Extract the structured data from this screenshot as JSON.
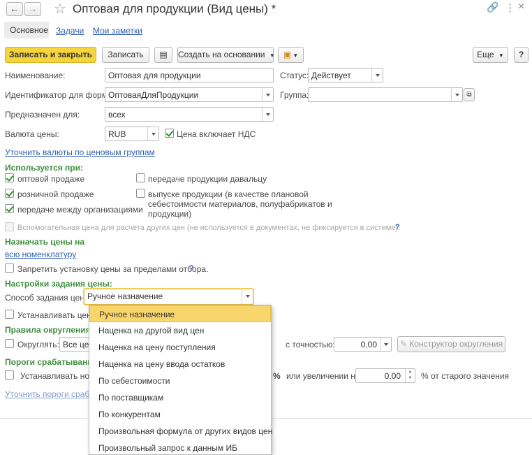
{
  "window": {
    "title": "Оптовая для продукции (Вид цены) *"
  },
  "tabs": [
    "Основное",
    "Задачи",
    "Мои заметки"
  ],
  "toolbar": {
    "save_close": "Записать и закрыть",
    "save": "Записать",
    "create_based": "Создать на основании",
    "more": "Еще",
    "help": "?"
  },
  "form": {
    "name_label": "Наименование:",
    "name_value": "Оптовая для продукции",
    "status_label": "Статус:",
    "status_value": "Действует",
    "formula_id_label": "Идентификатор для формул:",
    "formula_id_value": "ОптоваяДляПродукции",
    "group_label": "Группа:",
    "group_value": "",
    "intended_label": "Предназначен для:",
    "intended_value": "всех",
    "currency_label": "Валюта цены:",
    "currency_value": "RUB",
    "vat_label": "Цена включает НДС",
    "vat_checked": true,
    "refine_currency_link": "Уточнить валюты по ценовым группам"
  },
  "used_for": {
    "header": "Используется при:",
    "items": [
      {
        "label": "оптовой продаже",
        "checked": true
      },
      {
        "label": "розничной продаже",
        "checked": true
      },
      {
        "label": "передаче между организациями",
        "checked": true
      },
      {
        "label": "передаче продукции давальцу",
        "checked": false
      },
      {
        "label": "выпуске продукции (в качестве плановой",
        "checked": false
      }
    ],
    "production_line2": "себестоимости материалов, полуфабрикатов и",
    "production_line3": "продукции)",
    "aux_price": "Вспомогательная цена для расчета других цен (не используется в документах, не фиксируется в системе).",
    "aux_help": "?"
  },
  "assign": {
    "header": "Назначать цены на",
    "link": "всю номенклатуру",
    "forbid_label": "Запретить установку цены за пределами отбора.",
    "forbid_help": "?"
  },
  "settings": {
    "header": "Настройки задания цены:",
    "method_label": "Способ задания цены:",
    "method_value": "Ручное назначение",
    "set_price_label": "Устанавливать цену",
    "rounding_header": "Правила округления ц",
    "round_label": "Округлять:",
    "round_value": "Все це",
    "precision_label": "с точностью:",
    "precision_value": "0,00",
    "round_constructor": "Конструктор округления",
    "thresholds_header": "Пороги срабатывания",
    "set_new_label": "Устанавливать нову",
    "percent_sign": "%",
    "increase_label": "или увеличении на:",
    "increase_value": "0,00",
    "increase_suffix": "% от старого значения",
    "refine_thresholds_link": "Уточнить пороги срабат"
  },
  "dropdown": {
    "items": [
      "Ручное назначение",
      "Наценка на другой вид цен",
      "Наценка на цену поступления",
      "Наценка на цену ввода остатков",
      "По себестоимости",
      "По поставщикам",
      "По конкурентам",
      "Произвольная формула от других видов цен",
      "Произвольный запрос к данным ИБ"
    ],
    "selected": 0
  },
  "colors": {
    "accent_yellow": "#f9d66b",
    "section_green": "#3f8f3f",
    "link_blue": "#2f5fb0"
  }
}
